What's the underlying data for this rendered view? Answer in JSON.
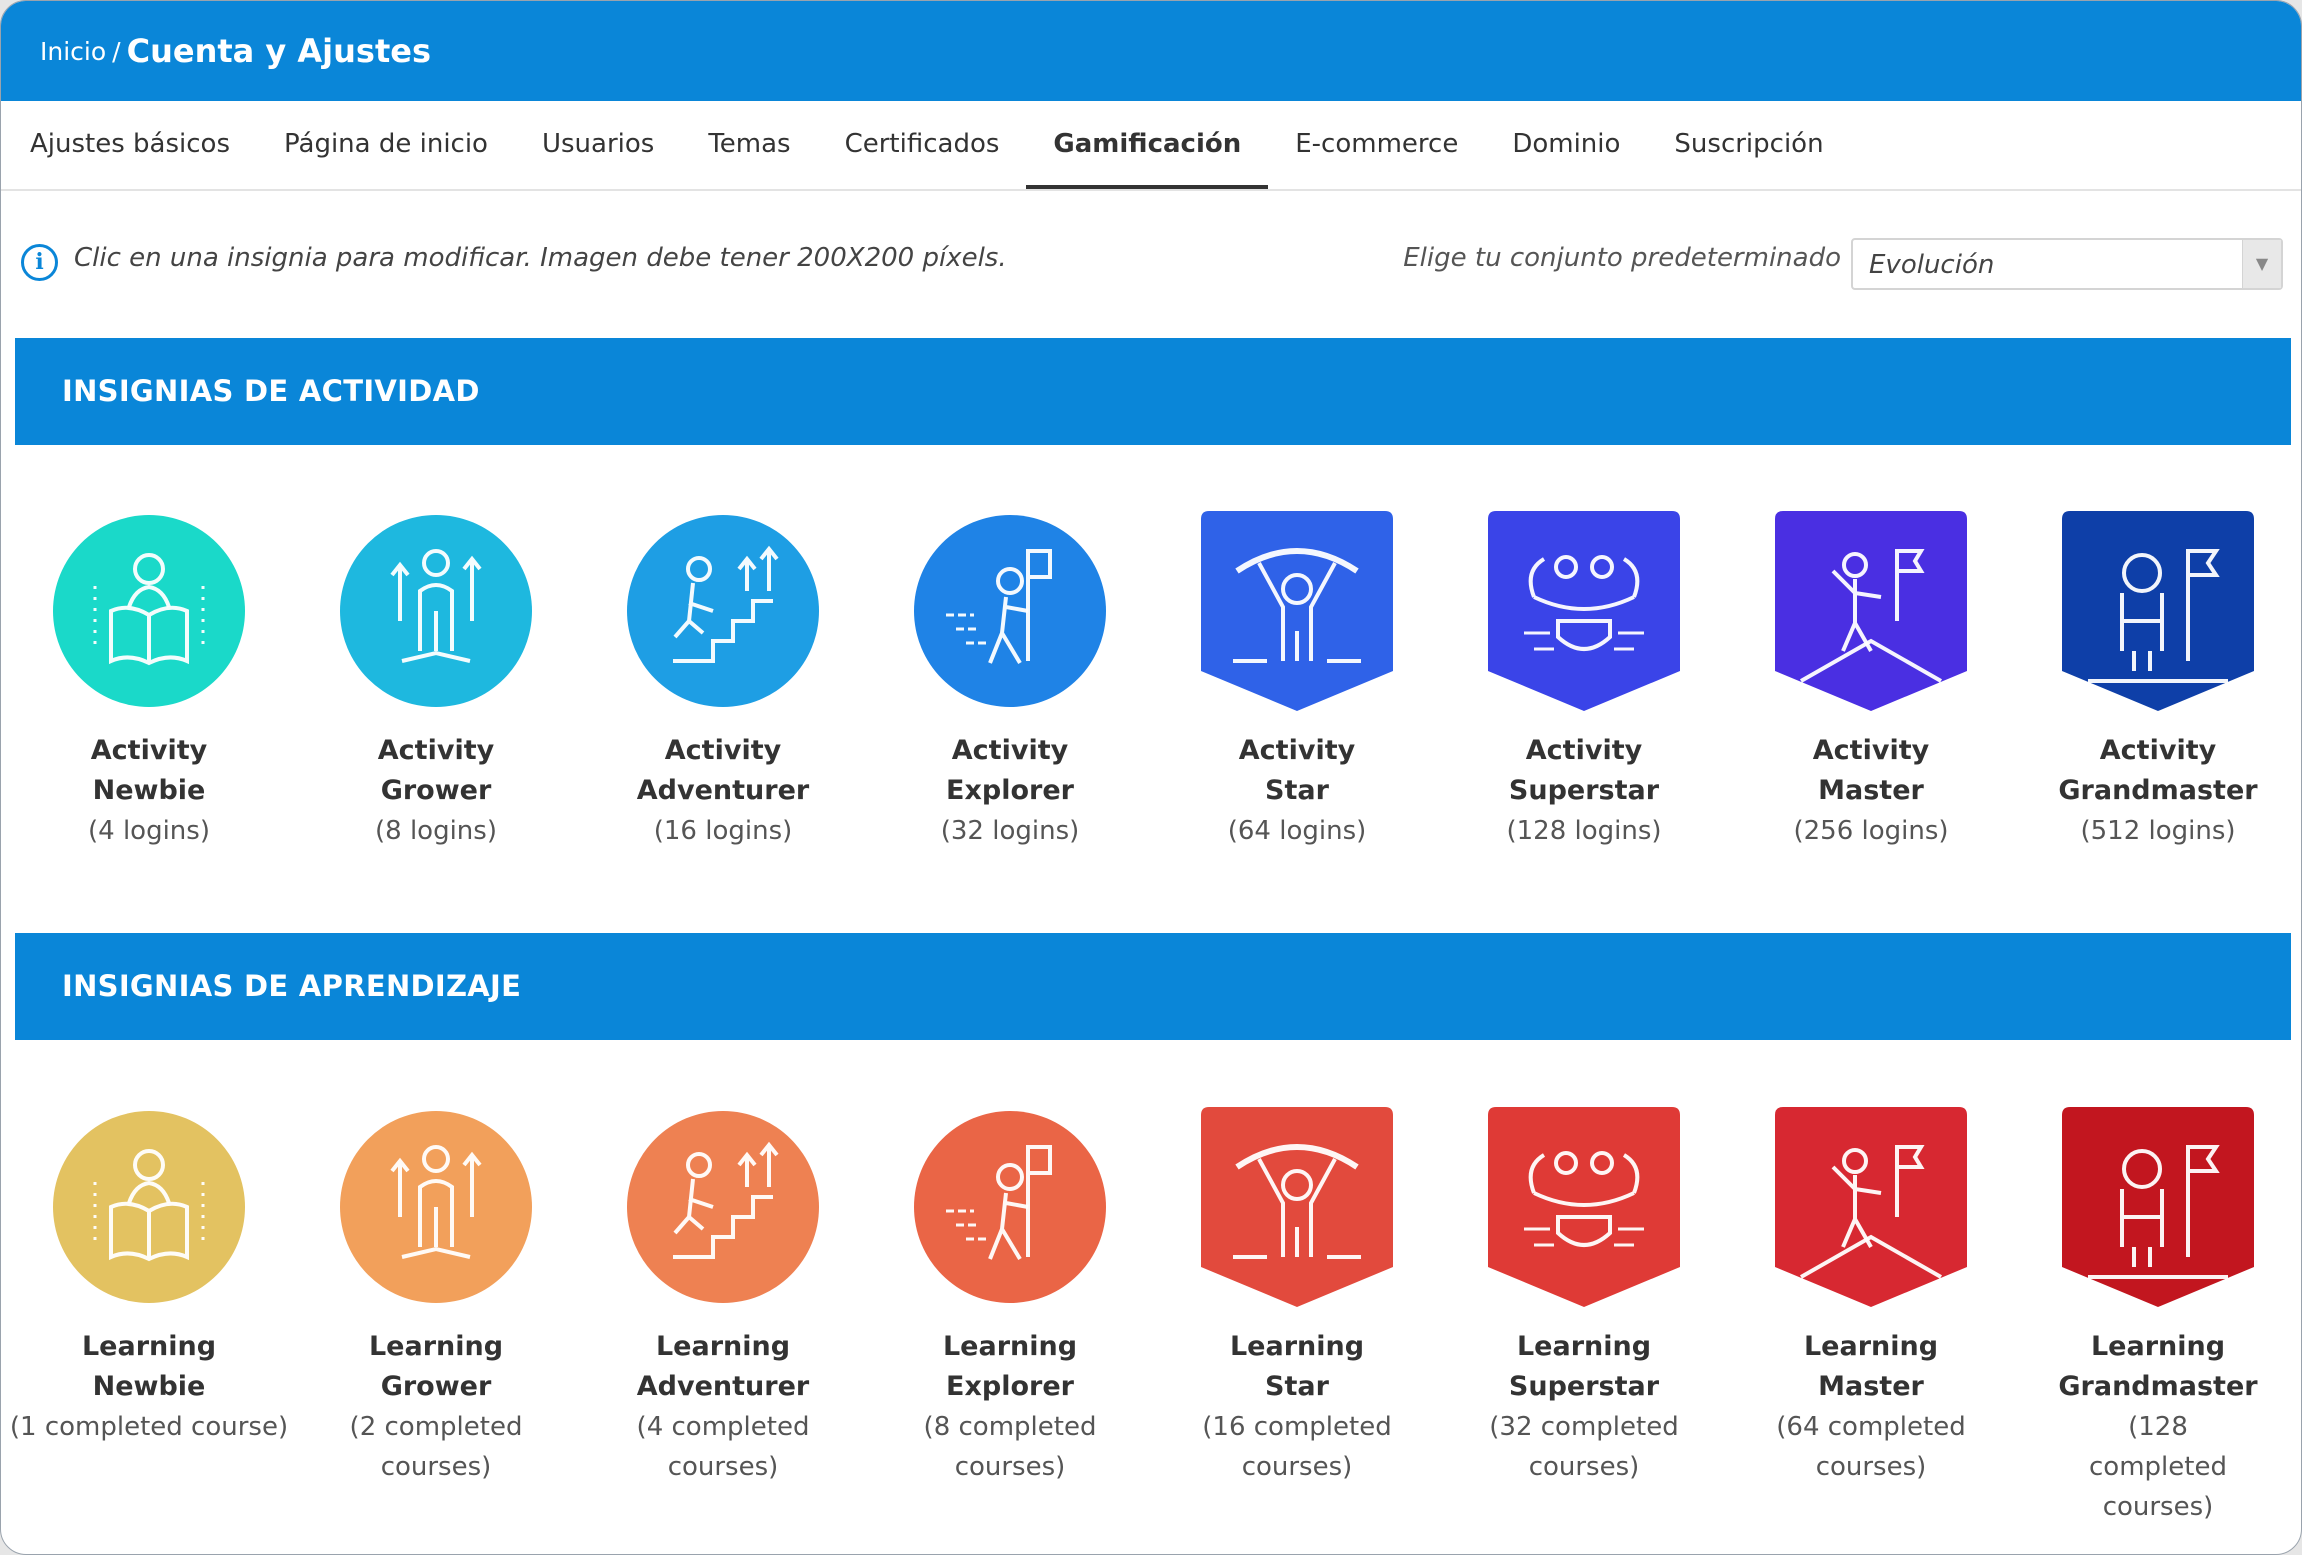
{
  "header": {
    "breadcrumb_home": "Inicio",
    "breadcrumb_sep": "/",
    "title": "Cuenta y Ajustes"
  },
  "tabs": [
    {
      "label": "Ajustes básicos"
    },
    {
      "label": "Página de inicio"
    },
    {
      "label": "Usuarios"
    },
    {
      "label": "Temas"
    },
    {
      "label": "Certificados"
    },
    {
      "label": "Gamificación",
      "active": true
    },
    {
      "label": "E-commerce"
    },
    {
      "label": "Dominio"
    },
    {
      "label": "Suscripción"
    }
  ],
  "info": {
    "icon": "info-icon",
    "text": "Clic en una insignia para modificar. Imagen debe tener 200X200 píxels.",
    "set_label": "Elige tu conjunto predeterminado",
    "set_value": "Evolución"
  },
  "colors": {
    "brand": "#0a86d8"
  },
  "sections": [
    {
      "title": "INSIGNIAS DE ACTIVIDAD",
      "badges": [
        {
          "line1": "Activity",
          "line2": "Newbie",
          "desc": "(4 logins)",
          "color": "#1ad9c9",
          "shape": "circle",
          "icon": "reading-person-icon"
        },
        {
          "line1": "Activity",
          "line2": "Grower",
          "desc": "(8 logins)",
          "color": "#1eb8df",
          "shape": "circle",
          "icon": "growing-person-icon"
        },
        {
          "line1": "Activity",
          "line2": "Adventurer",
          "desc": "(16 logins)",
          "color": "#1e9ee4",
          "shape": "circle",
          "icon": "climbing-stairs-icon"
        },
        {
          "line1": "Activity",
          "line2": "Explorer",
          "desc": "(32 logins)",
          "color": "#1f83e6",
          "shape": "circle",
          "icon": "flag-walker-icon"
        },
        {
          "line1": "Activity",
          "line2": "Star",
          "desc": "(64 logins)",
          "color": "#2f62e8",
          "shape": "shield",
          "icon": "champion-icon"
        },
        {
          "line1": "Activity",
          "line2": "Superstar",
          "desc": "(128 logins)",
          "color": "#3a44e8",
          "shape": "shield",
          "icon": "strong-hero-icon"
        },
        {
          "line1": "Activity",
          "line2": "Master",
          "desc": "(256 logins)",
          "color": "#4a2fe2",
          "shape": "shield",
          "icon": "summit-flag-icon"
        },
        {
          "line1": "Activity",
          "line2": "Grandmaster",
          "desc": "(512 logins)",
          "color": "#0e3fa8",
          "shape": "shield",
          "icon": "astronaut-flag-icon"
        }
      ]
    },
    {
      "title": "INSIGNIAS DE APRENDIZAJE",
      "badges": [
        {
          "line1": "Learning",
          "line2": "Newbie",
          "desc": "(1 completed course)",
          "color": "#e3c261",
          "shape": "circle",
          "icon": "reading-person-icon"
        },
        {
          "line1": "Learning",
          "line2": "Grower",
          "desc": "(2 completed courses)",
          "color": "#f2a05b",
          "shape": "circle",
          "icon": "growing-person-icon"
        },
        {
          "line1": "Learning",
          "line2": "Adventurer",
          "desc": "(4 completed courses)",
          "color": "#ee8152",
          "shape": "circle",
          "icon": "climbing-stairs-icon"
        },
        {
          "line1": "Learning",
          "line2": "Explorer",
          "desc": "(8 completed courses)",
          "color": "#ea6546",
          "shape": "circle",
          "icon": "flag-walker-icon"
        },
        {
          "line1": "Learning",
          "line2": "Star",
          "desc": "(16 completed courses)",
          "color": "#e24a3d",
          "shape": "shield",
          "icon": "champion-icon"
        },
        {
          "line1": "Learning",
          "line2": "Superstar",
          "desc": "(32 completed courses)",
          "color": "#df3a36",
          "shape": "shield",
          "icon": "strong-hero-icon"
        },
        {
          "line1": "Learning",
          "line2": "Master",
          "desc": "(64 completed courses)",
          "color": "#d72831",
          "shape": "shield",
          "icon": "summit-flag-icon"
        },
        {
          "line1": "Learning",
          "line2": "Grandmaster",
          "desc": "(128 completed courses)",
          "color": "#c2161f",
          "shape": "shield",
          "icon": "astronaut-flag-icon"
        }
      ]
    }
  ]
}
